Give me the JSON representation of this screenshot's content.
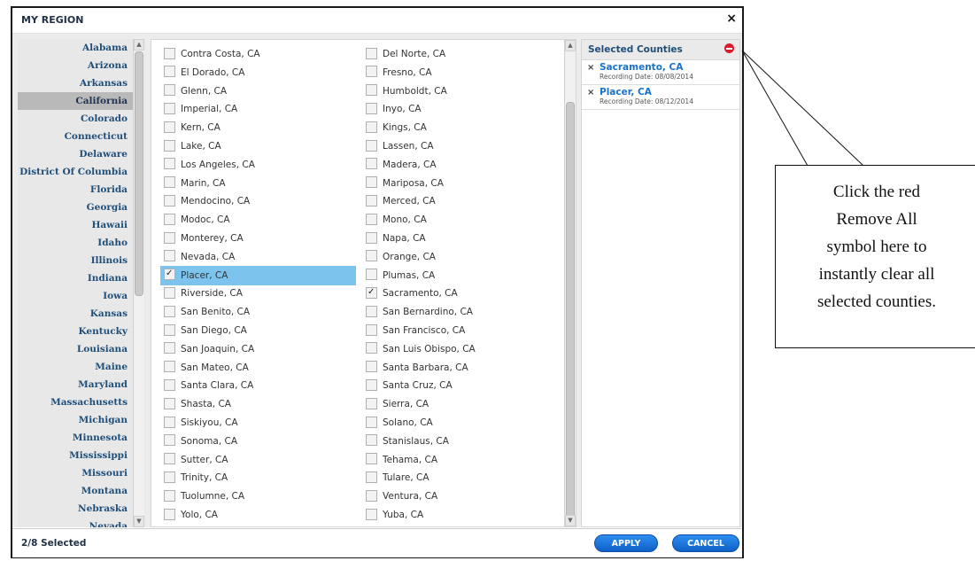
{
  "dialog": {
    "title": "MY REGION",
    "close_symbol": "×"
  },
  "states": [
    "Alabama",
    "Arizona",
    "Arkansas",
    "California",
    "Colorado",
    "Connecticut",
    "Delaware",
    "District Of Columbia",
    "Florida",
    "Georgia",
    "Hawaii",
    "Idaho",
    "Illinois",
    "Indiana",
    "Iowa",
    "Kansas",
    "Kentucky",
    "Louisiana",
    "Maine",
    "Maryland",
    "Massachusetts",
    "Michigan",
    "Minnesota",
    "Mississippi",
    "Missouri",
    "Montana",
    "Nebraska",
    "Nevada"
  ],
  "active_state": "California",
  "counties_col1": [
    {
      "label": "Contra Costa, CA",
      "checked": false
    },
    {
      "label": "El Dorado, CA",
      "checked": false
    },
    {
      "label": "Glenn, CA",
      "checked": false
    },
    {
      "label": "Imperial, CA",
      "checked": false
    },
    {
      "label": "Kern, CA",
      "checked": false
    },
    {
      "label": "Lake, CA",
      "checked": false
    },
    {
      "label": "Los Angeles, CA",
      "checked": false
    },
    {
      "label": "Marin, CA",
      "checked": false
    },
    {
      "label": "Mendocino, CA",
      "checked": false
    },
    {
      "label": "Modoc, CA",
      "checked": false
    },
    {
      "label": "Monterey, CA",
      "checked": false
    },
    {
      "label": "Nevada, CA",
      "checked": false
    },
    {
      "label": "Placer, CA",
      "checked": true,
      "highlight": true
    },
    {
      "label": "Riverside, CA",
      "checked": false
    },
    {
      "label": "San Benito, CA",
      "checked": false
    },
    {
      "label": "San Diego, CA",
      "checked": false
    },
    {
      "label": "San Joaquin, CA",
      "checked": false
    },
    {
      "label": "San Mateo, CA",
      "checked": false
    },
    {
      "label": "Santa Clara, CA",
      "checked": false
    },
    {
      "label": "Shasta, CA",
      "checked": false
    },
    {
      "label": "Siskiyou, CA",
      "checked": false
    },
    {
      "label": "Sonoma, CA",
      "checked": false
    },
    {
      "label": "Sutter, CA",
      "checked": false
    },
    {
      "label": "Trinity, CA",
      "checked": false
    },
    {
      "label": "Tuolumne, CA",
      "checked": false
    },
    {
      "label": "Yolo, CA",
      "checked": false
    }
  ],
  "counties_col2": [
    {
      "label": "Del Norte, CA",
      "checked": false
    },
    {
      "label": "Fresno, CA",
      "checked": false
    },
    {
      "label": "Humboldt, CA",
      "checked": false
    },
    {
      "label": "Inyo, CA",
      "checked": false
    },
    {
      "label": "Kings, CA",
      "checked": false
    },
    {
      "label": "Lassen, CA",
      "checked": false
    },
    {
      "label": "Madera, CA",
      "checked": false
    },
    {
      "label": "Mariposa, CA",
      "checked": false
    },
    {
      "label": "Merced, CA",
      "checked": false
    },
    {
      "label": "Mono, CA",
      "checked": false
    },
    {
      "label": "Napa, CA",
      "checked": false
    },
    {
      "label": "Orange, CA",
      "checked": false
    },
    {
      "label": "Plumas, CA",
      "checked": false
    },
    {
      "label": "Sacramento, CA",
      "checked": true
    },
    {
      "label": "San Bernardino, CA",
      "checked": false
    },
    {
      "label": "San Francisco, CA",
      "checked": false
    },
    {
      "label": "San Luis Obispo, CA",
      "checked": false
    },
    {
      "label": "Santa Barbara, CA",
      "checked": false
    },
    {
      "label": "Santa Cruz, CA",
      "checked": false
    },
    {
      "label": "Sierra, CA",
      "checked": false
    },
    {
      "label": "Solano, CA",
      "checked": false
    },
    {
      "label": "Stanislaus, CA",
      "checked": false
    },
    {
      "label": "Tehama, CA",
      "checked": false
    },
    {
      "label": "Tulare, CA",
      "checked": false
    },
    {
      "label": "Ventura, CA",
      "checked": false
    },
    {
      "label": "Yuba, CA",
      "checked": false
    }
  ],
  "selected_panel": {
    "title": "Selected Counties",
    "items": [
      {
        "name": "Sacramento, CA",
        "date": "Recording Date: 08/08/2014"
      },
      {
        "name": "Placer, CA",
        "date": "Recording Date: 08/12/2014"
      }
    ],
    "remove_symbol": "×"
  },
  "footer": {
    "status": "2/8 Selected",
    "apply_label": "APPLY",
    "cancel_label": "CANCEL"
  },
  "callout": {
    "lines": [
      "Click the red",
      "Remove All",
      "symbol here to",
      "instantly clear all",
      "selected counties."
    ]
  },
  "colors": {
    "link_blue": "#1a73c9",
    "highlight_blue": "#7cc3ee",
    "remove_red": "#d81e28",
    "button_blue": "#1e78e0"
  }
}
